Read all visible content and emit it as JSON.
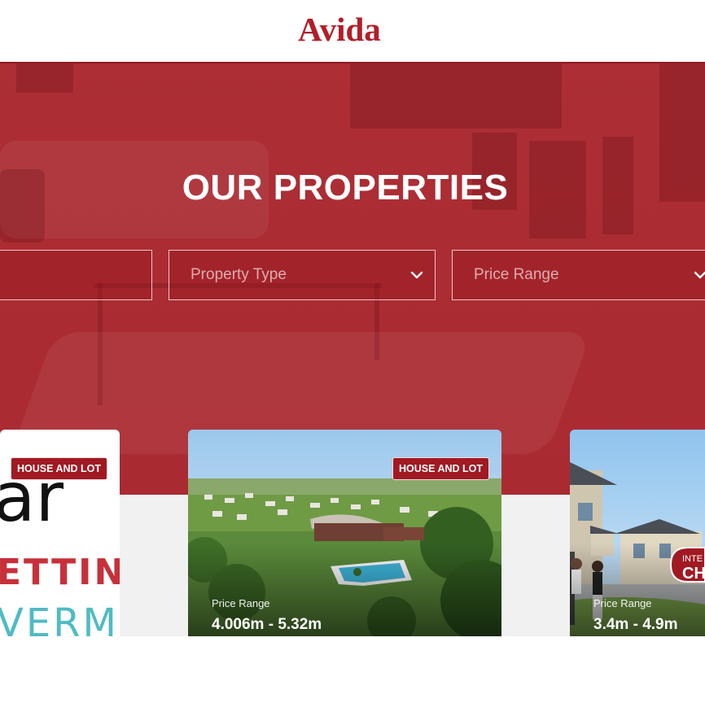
{
  "header": {
    "logo": "Avida"
  },
  "hero": {
    "title": "OUR PROPERTIES",
    "filters": {
      "location_placeholder": "",
      "property_type_placeholder": "Property Type",
      "price_range_placeholder": "Price Range"
    }
  },
  "listings": [
    {
      "badge": "HOUSE AND LOT",
      "logo_text_1": "ar",
      "logo_text_2": "ETTIN",
      "logo_text_3": "VERMO"
    },
    {
      "badge": "HOUSE AND LOT",
      "price_label": "Price Range",
      "price_value": "4.006m - 5.32m"
    },
    {
      "badge_partial": "INTE",
      "badge_partial_2": "CH",
      "price_label": "Price Range",
      "price_value": "3.4m - 4.9m"
    }
  ],
  "colors": {
    "brand": "#b21e28",
    "overlay": "#a81c24",
    "badge": "#a11a23"
  }
}
